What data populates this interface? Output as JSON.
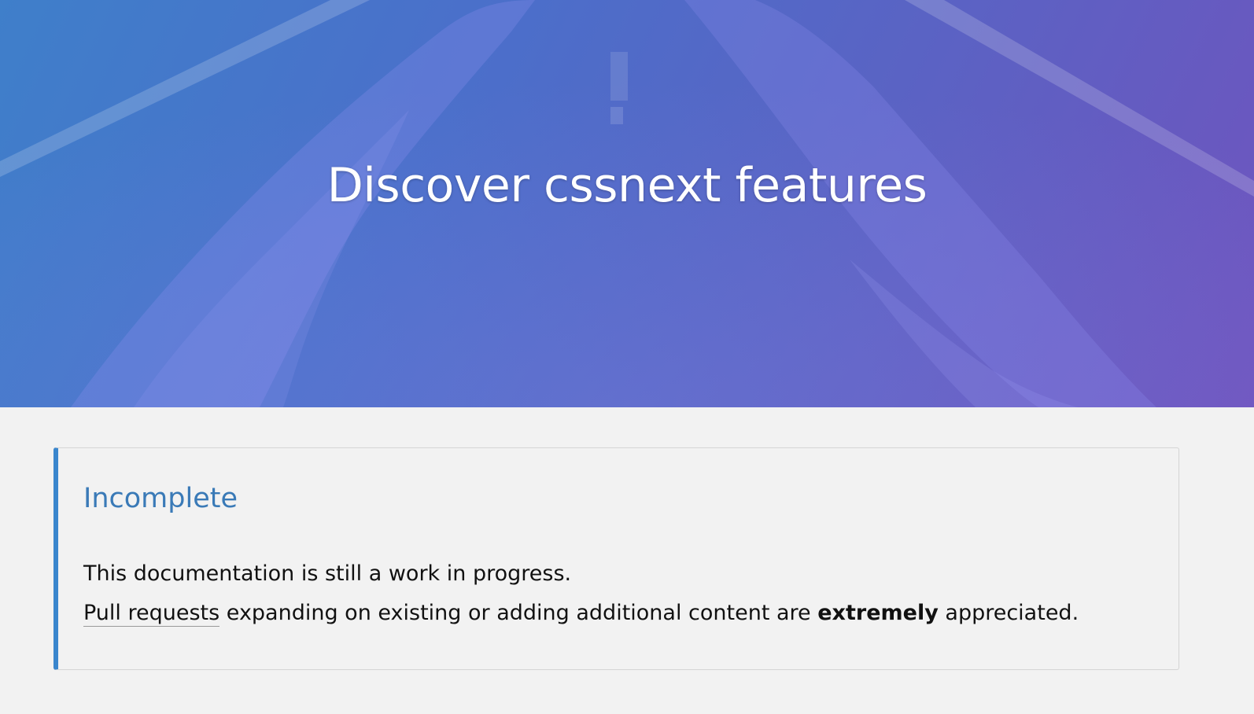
{
  "hero": {
    "title": "Discover cssnext features",
    "gradient_colors": [
      "#3f7fca",
      "#4b6fca",
      "#5a63c4",
      "#6f54be"
    ]
  },
  "notice": {
    "title": "Incomplete",
    "accent_color": "#3a86cd",
    "line1": "This documentation is still a work in progress.",
    "line2": {
      "link_text": "Pull requests",
      "before_bold": " expanding on existing or adding additional content are ",
      "bold": "extremely",
      "after_bold": " appreciated."
    }
  }
}
